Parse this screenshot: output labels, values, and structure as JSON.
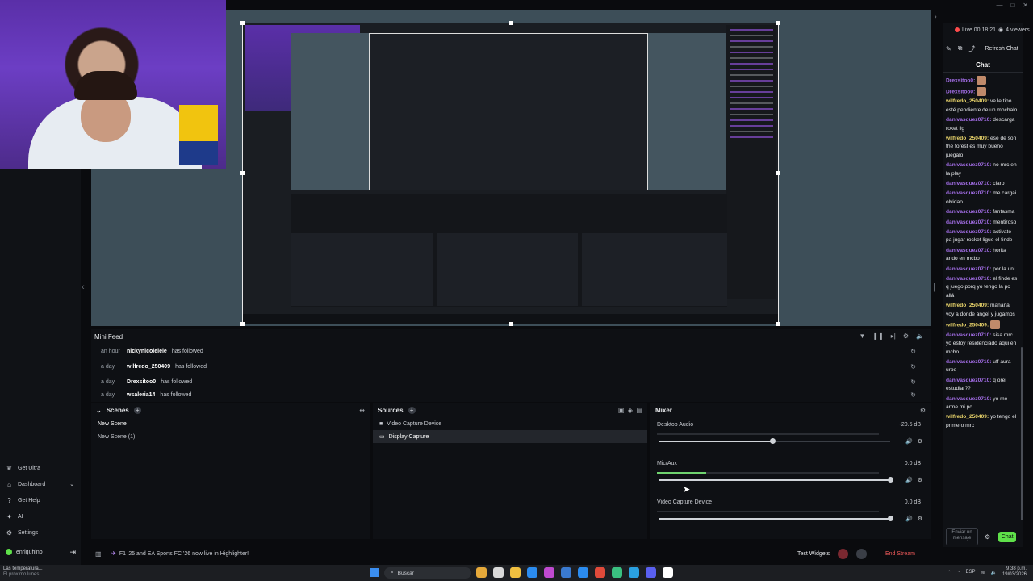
{
  "window": {
    "controls": [
      "—",
      "□",
      "✕"
    ]
  },
  "left_nav": {
    "items": [
      {
        "icon": "crown-icon",
        "glyph": "♛",
        "label": "Get Ultra"
      },
      {
        "icon": "dashboard-icon",
        "glyph": "⌂",
        "label": "Dashboard",
        "chevron": "⌄"
      },
      {
        "icon": "help-icon",
        "glyph": "?",
        "label": "Get Help"
      },
      {
        "icon": "ai-icon",
        "glyph": "✦",
        "label": "AI"
      },
      {
        "icon": "gear-icon",
        "glyph": "⚙",
        "label": "Settings"
      }
    ],
    "user": {
      "name": "enriquhino",
      "logout_glyph": "⇥"
    }
  },
  "mini_feed": {
    "title": "Mini Feed",
    "rows": [
      {
        "when": "an hour",
        "who": "nickynicolelele",
        "event": "has followed"
      },
      {
        "when": "a day",
        "who": "wilfredo_250409",
        "event": "has followed"
      },
      {
        "when": "a day",
        "who": "Drexsitoo0",
        "event": "has followed"
      },
      {
        "when": "a day",
        "who": "wsaleria14",
        "event": "has followed"
      }
    ]
  },
  "scenes": {
    "title": "Scenes",
    "items": [
      "New Scene",
      "New Scene (1)"
    ],
    "active_index": 0
  },
  "sources": {
    "title": "Sources",
    "items": [
      {
        "label": "Video Capture Device",
        "icon": "lock-icon",
        "glyph": "🔒",
        "selected": false
      },
      {
        "label": "Display Capture",
        "icon": "monitor-icon",
        "glyph": "▭",
        "selected": true
      }
    ]
  },
  "mixer": {
    "title": "Mixer",
    "channels": [
      {
        "name": "Desktop Audio",
        "db": "-20.5 dB",
        "volume": 0.49,
        "meter": 0.0
      },
      {
        "name": "Mic/Aux",
        "db": "0.0 dB",
        "volume": 1.0,
        "meter": 0.22
      },
      {
        "name": "Video Capture Device",
        "db": "0.0 dB",
        "volume": 1.0,
        "meter": 0.0
      }
    ]
  },
  "status_bar": {
    "promo": "F1 '25 and EA Sports FC '26 now live in Highlighter!",
    "test_widgets": "Test Widgets",
    "end_stream": "End Stream"
  },
  "chat": {
    "live": "Live 00:18:21",
    "viewers": "4 viewers",
    "refresh": "Refresh Chat",
    "title": "Chat",
    "messages": [
      {
        "user": "Drexsitoo0:",
        "color": "purple",
        "text": "",
        "emote": true
      },
      {
        "user": "Drexsitoo0:",
        "color": "purple",
        "text": "",
        "emote": true
      },
      {
        "user": "wilfredo_250409:",
        "color": "yellow",
        "text": "ve le tipo esté pendiente de un mochalo"
      },
      {
        "user": "danivasquez0710:",
        "color": "purple",
        "text": "descarga roket lig"
      },
      {
        "user": "wilfredo_250409:",
        "color": "yellow",
        "text": "ese de son the forest es muy bueno juegalo"
      },
      {
        "user": "danivasquez0710:",
        "color": "purple",
        "text": "no mrc en la play"
      },
      {
        "user": "danivasquez0710:",
        "color": "purple",
        "text": "claro"
      },
      {
        "user": "danivasquez0710:",
        "color": "purple",
        "text": "me cargai olvidao"
      },
      {
        "user": "danivasquez0710:",
        "color": "purple",
        "text": "fantasma"
      },
      {
        "user": "danivasquez0710:",
        "color": "purple",
        "text": "mentiroso"
      },
      {
        "user": "danivasquez0710:",
        "color": "purple",
        "text": "activate pa jugar rocket ligue el finde"
      },
      {
        "user": "danivasquez0710:",
        "color": "purple",
        "text": "horita ando en mcbo"
      },
      {
        "user": "danivasquez0710:",
        "color": "purple",
        "text": "por la uni"
      },
      {
        "user": "danivasquez0710:",
        "color": "purple",
        "text": "el finde es q juego porq yo tengo la pc allá"
      },
      {
        "user": "wilfredo_250409:",
        "color": "yellow",
        "text": "mañana voy a donde angel y jugamos"
      },
      {
        "user": "wilfredo_250409:",
        "color": "yellow",
        "text": "",
        "emote": true
      },
      {
        "user": "danivasquez0710:",
        "color": "purple",
        "text": "sisa mrc yo estoy residenciado aqui en mcbo"
      },
      {
        "user": "danivasquez0710:",
        "color": "purple",
        "text": "uff aura urbe"
      },
      {
        "user": "danivasquez0710:",
        "color": "purple",
        "text": "q orei estudiar??"
      },
      {
        "user": "danivasquez0710:",
        "color": "purple",
        "text": "yo me arme mi pc"
      },
      {
        "user": "wilfredo_250409:",
        "color": "yellow",
        "text": "yo tengo el primero mrc"
      }
    ],
    "input_placeholder": "Enviar un mensaje",
    "send_label": "Chat"
  },
  "taskbar": {
    "weather_line1": "Las temperatura...",
    "weather_line2": "El próximo lunes",
    "search_placeholder": "Buscar",
    "lang": "ESP",
    "time": "9:38 p.m.",
    "date": "19/03/2026",
    "app_colors": [
      "#e6a93a",
      "#d9d9d9",
      "#f0c040",
      "#2b8cf0",
      "#c04ad0",
      "#3a7ad0",
      "#2b8cf0",
      "#e04a3a",
      "#3ac080",
      "#2aa0e0",
      "#5a60f0",
      "#ffffff"
    ]
  },
  "colors": {
    "accent_green": "#5fe14a",
    "live_red": "#ff4b4b",
    "end_red": "#f05a5a",
    "purple_user": "#a46ee8",
    "yellow_user": "#e8d36a"
  }
}
